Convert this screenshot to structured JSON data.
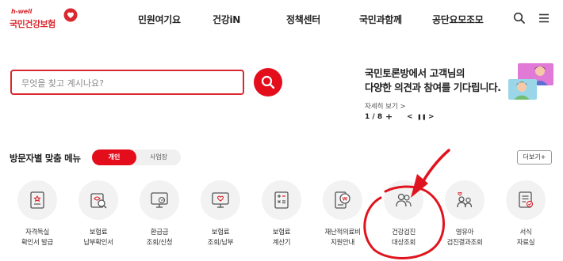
{
  "logo": {
    "small": "h-well",
    "main": "국민건강보험"
  },
  "nav": [
    "민원여기요",
    "건강iN",
    "정책센터",
    "국민과함께",
    "공단요모조모"
  ],
  "search": {
    "placeholder": "무엇을 찾고 계시나요?"
  },
  "notice": {
    "line1": "국민토론방에서 고객님의",
    "line2": "다양한 의견과 참여를 기다립니다.",
    "more": "자세히 보기 >",
    "page": "1 / 8",
    "plus": "+",
    "prev": "<",
    "pause": "❚❚",
    "next": ">"
  },
  "menu": {
    "title": "방문자별 맞춤 메뉴",
    "tab_personal": "개인",
    "tab_business": "사업장",
    "more": "더보기+",
    "tiles": [
      {
        "icon": "certificate-icon",
        "line1": "자격득실",
        "line2": "확인서 발급"
      },
      {
        "icon": "payment-check-icon",
        "line1": "보험료",
        "line2": "납부확인서"
      },
      {
        "icon": "refund-monitor-icon",
        "line1": "환급금",
        "line2": "조회/신청"
      },
      {
        "icon": "payment-monitor-icon",
        "line1": "보험료",
        "line2": "조회/납부"
      },
      {
        "icon": "calculator-icon",
        "line1": "보험료",
        "line2": "계산기"
      },
      {
        "icon": "medical-cost-icon",
        "line1": "재난적의료비",
        "line2": "지원안내"
      },
      {
        "icon": "people-search-icon",
        "line1": "건강검진",
        "line2": "대상조회"
      },
      {
        "icon": "infant-people-icon",
        "line1": "영유아",
        "line2": "검진결과조회"
      },
      {
        "icon": "data-doc-icon",
        "line1": "서식",
        "line2": "자료실"
      }
    ]
  },
  "colors": {
    "brand_red": "#e30d1c",
    "annotation_red": "#e0141e"
  }
}
